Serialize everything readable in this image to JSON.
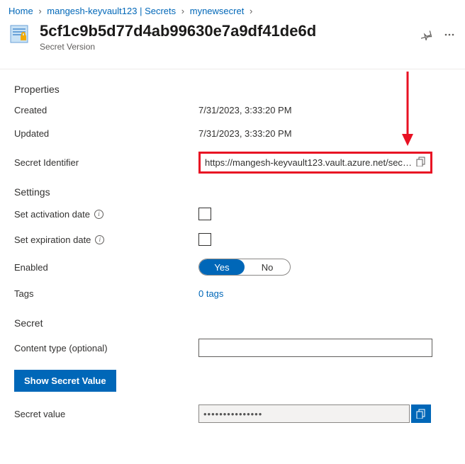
{
  "breadcrumb": {
    "home": "Home",
    "vault": "mangesh-keyvault123 | Secrets",
    "secret": "mynewsecret"
  },
  "header": {
    "title": "5cf1c9b5d77d4ab99630e7a9df41de6d",
    "subtitle": "Secret Version"
  },
  "sections": {
    "properties": "Properties",
    "settings": "Settings",
    "secret": "Secret"
  },
  "fields": {
    "created": {
      "label": "Created",
      "value": "7/31/2023, 3:33:20 PM"
    },
    "updated": {
      "label": "Updated",
      "value": "7/31/2023, 3:33:20 PM"
    },
    "secretId": {
      "label": "Secret Identifier",
      "value": "https://mangesh-keyvault123.vault.azure.net/secr..."
    },
    "activation": {
      "label": "Set activation date"
    },
    "expiration": {
      "label": "Set expiration date"
    },
    "enabled": {
      "label": "Enabled",
      "yes": "Yes",
      "no": "No"
    },
    "tags": {
      "label": "Tags",
      "value": "0 tags"
    },
    "contentType": {
      "label": "Content type (optional)",
      "value": ""
    },
    "secretValue": {
      "label": "Secret value",
      "value": "***************"
    }
  },
  "buttons": {
    "showSecret": "Show Secret Value"
  }
}
